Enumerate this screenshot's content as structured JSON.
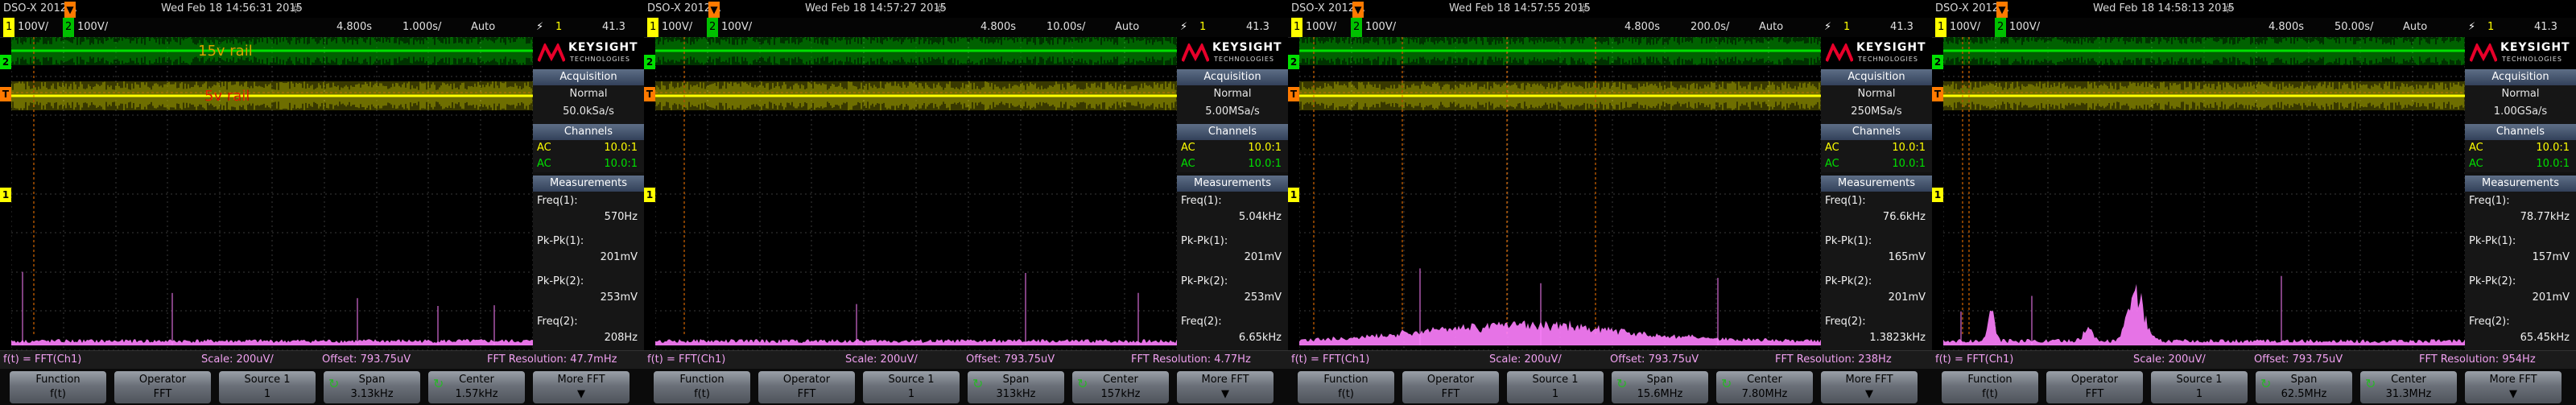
{
  "screens": [
    {
      "topbar": {
        "model": "DSO-X 2012A,",
        "datetime": "Wed Feb 18 14:56:31 2015"
      },
      "status": {
        "ch1": "1",
        "ch1_scale": "100V/",
        "ch2": "2",
        "ch2_scale": "100V/",
        "delay": "4.800s",
        "timebase": "1.000s/",
        "mode": "Auto",
        "trig_ch": "1",
        "trig_level": "41.3"
      },
      "annotations": [
        {
          "text": "15v rail",
          "color": "#d8a000"
        },
        {
          "text": "5v rail",
          "color": "#e02000"
        }
      ],
      "side": {
        "acq_title": "Acquisition",
        "acq_mode": "Normal",
        "acq_rate": "50.0kSa/s",
        "ch_title": "Channels",
        "channels": [
          {
            "coupling": "AC",
            "probe": "10.0:1"
          },
          {
            "coupling": "AC",
            "probe": "10.0:1"
          }
        ],
        "meas_title": "Measurements",
        "measurements": [
          {
            "label": "Freq(1):",
            "value": "570Hz"
          },
          {
            "label": "Pk-Pk(1):",
            "value": "201mV"
          },
          {
            "label": "Pk-Pk(2):",
            "value": "253mV"
          },
          {
            "label": "Freq(2):",
            "value": "208Hz"
          }
        ]
      },
      "math": {
        "function": "f(t) = FFT(Ch1)",
        "scale": "Scale: 200uV/",
        "offset": "Offset: 793.75uV",
        "resolution": "FFT Resolution: 47.7mHz"
      },
      "softkeys": [
        {
          "label": "Function",
          "value": "f(t)"
        },
        {
          "label": "Operator",
          "value": "FFT"
        },
        {
          "label": "Source 1",
          "value": "1"
        },
        {
          "label": "Span",
          "value": "3.13kHz"
        },
        {
          "label": "Center",
          "value": "1.57kHz"
        },
        {
          "label": "More FFT",
          "value": ""
        }
      ],
      "fft_profile": "spikes"
    },
    {
      "topbar": {
        "model": "DSO-X 2012A,",
        "datetime": "Wed Feb 18 14:57:27 2015"
      },
      "status": {
        "ch1": "1",
        "ch1_scale": "100V/",
        "ch2": "2",
        "ch2_scale": "100V/",
        "delay": "4.800s",
        "timebase": "10.00s/",
        "mode": "Auto",
        "trig_ch": "1",
        "trig_level": "41.3"
      },
      "annotations": [],
      "side": {
        "acq_title": "Acquisition",
        "acq_mode": "Normal",
        "acq_rate": "5.00MSa/s",
        "ch_title": "Channels",
        "channels": [
          {
            "coupling": "AC",
            "probe": "10.0:1"
          },
          {
            "coupling": "AC",
            "probe": "10.0:1"
          }
        ],
        "meas_title": "Measurements",
        "measurements": [
          {
            "label": "Freq(1):",
            "value": "5.04kHz"
          },
          {
            "label": "Pk-Pk(1):",
            "value": "201mV"
          },
          {
            "label": "Pk-Pk(2):",
            "value": "253mV"
          },
          {
            "label": "Freq(2):",
            "value": "6.65kHz"
          }
        ]
      },
      "math": {
        "function": "f(t) = FFT(Ch1)",
        "scale": "Scale: 200uV/",
        "offset": "Offset: 793.75uV",
        "resolution": "FFT Resolution: 4.77Hz"
      },
      "softkeys": [
        {
          "label": "Function",
          "value": "f(t)"
        },
        {
          "label": "Operator",
          "value": "FFT"
        },
        {
          "label": "Source 1",
          "value": "1"
        },
        {
          "label": "Span",
          "value": "313kHz"
        },
        {
          "label": "Center",
          "value": "157kHz"
        },
        {
          "label": "More FFT",
          "value": ""
        }
      ],
      "fft_profile": "sparse"
    },
    {
      "topbar": {
        "model": "DSO-X 2012A,",
        "datetime": "Wed Feb 18 14:57:55 2015"
      },
      "status": {
        "ch1": "1",
        "ch1_scale": "100V/",
        "ch2": "2",
        "ch2_scale": "100V/",
        "delay": "4.800s",
        "timebase": "200.0s/",
        "mode": "Auto",
        "trig_ch": "1",
        "trig_level": "41.3"
      },
      "annotations": [],
      "side": {
        "acq_title": "Acquisition",
        "acq_mode": "Normal",
        "acq_rate": "250MSa/s",
        "ch_title": "Channels",
        "channels": [
          {
            "coupling": "AC",
            "probe": "10.0:1"
          },
          {
            "coupling": "AC",
            "probe": "10.0:1"
          }
        ],
        "meas_title": "Measurements",
        "measurements": [
          {
            "label": "Freq(1):",
            "value": "76.6kHz"
          },
          {
            "label": "Pk-Pk(1):",
            "value": "165mV"
          },
          {
            "label": "Pk-Pk(2):",
            "value": "201mV"
          },
          {
            "label": "Freq(2):",
            "value": "1.3823kHz"
          }
        ]
      },
      "math": {
        "function": "f(t) = FFT(Ch1)",
        "scale": "Scale: 200uV/",
        "offset": "Offset: 793.75uV",
        "resolution": "FFT Resolution: 238Hz"
      },
      "softkeys": [
        {
          "label": "Function",
          "value": "f(t)"
        },
        {
          "label": "Operator",
          "value": "FFT"
        },
        {
          "label": "Source 1",
          "value": "1"
        },
        {
          "label": "Span",
          "value": "15.6MHz"
        },
        {
          "label": "Center",
          "value": "7.80MHz"
        },
        {
          "label": "More FFT",
          "value": ""
        }
      ],
      "fft_profile": "hump"
    },
    {
      "topbar": {
        "model": "DSO-X 2012A,",
        "datetime": "Wed Feb 18 14:58:13 2015"
      },
      "status": {
        "ch1": "1",
        "ch1_scale": "100V/",
        "ch2": "2",
        "ch2_scale": "100V/",
        "delay": "4.800s",
        "timebase": "50.00s/",
        "mode": "Auto",
        "trig_ch": "1",
        "trig_level": "41.3"
      },
      "annotations": [],
      "side": {
        "acq_title": "Acquisition",
        "acq_mode": "Normal",
        "acq_rate": "1.00GSa/s",
        "ch_title": "Channels",
        "channels": [
          {
            "coupling": "AC",
            "probe": "10.0:1"
          },
          {
            "coupling": "AC",
            "probe": "10.0:1"
          }
        ],
        "meas_title": "Measurements",
        "measurements": [
          {
            "label": "Freq(1):",
            "value": "78.77kHz"
          },
          {
            "label": "Pk-Pk(1):",
            "value": "157mV"
          },
          {
            "label": "Pk-Pk(2):",
            "value": "201mV"
          },
          {
            "label": "Freq(2):",
            "value": "65.45kHz"
          }
        ]
      },
      "math": {
        "function": "f(t) = FFT(Ch1)",
        "scale": "Scale: 200uV/",
        "offset": "Offset: 793.75uV",
        "resolution": "FFT Resolution: 954Hz"
      },
      "softkeys": [
        {
          "label": "Function",
          "value": "f(t)"
        },
        {
          "label": "Operator",
          "value": "FFT"
        },
        {
          "label": "Source 1",
          "value": "1"
        },
        {
          "label": "Span",
          "value": "62.5MHz"
        },
        {
          "label": "Center",
          "value": "31.3MHz"
        },
        {
          "label": "More FFT",
          "value": ""
        }
      ],
      "fft_profile": "peaks"
    }
  ],
  "brand": {
    "name": "KEYSIGHT",
    "sub": "TECHNOLOGIES"
  },
  "colors": {
    "ch1": "#ffff00",
    "ch2": "#00e000",
    "math": "#ff80ff",
    "trigger": "#ff7a00",
    "grid": "#3a3a3a"
  }
}
